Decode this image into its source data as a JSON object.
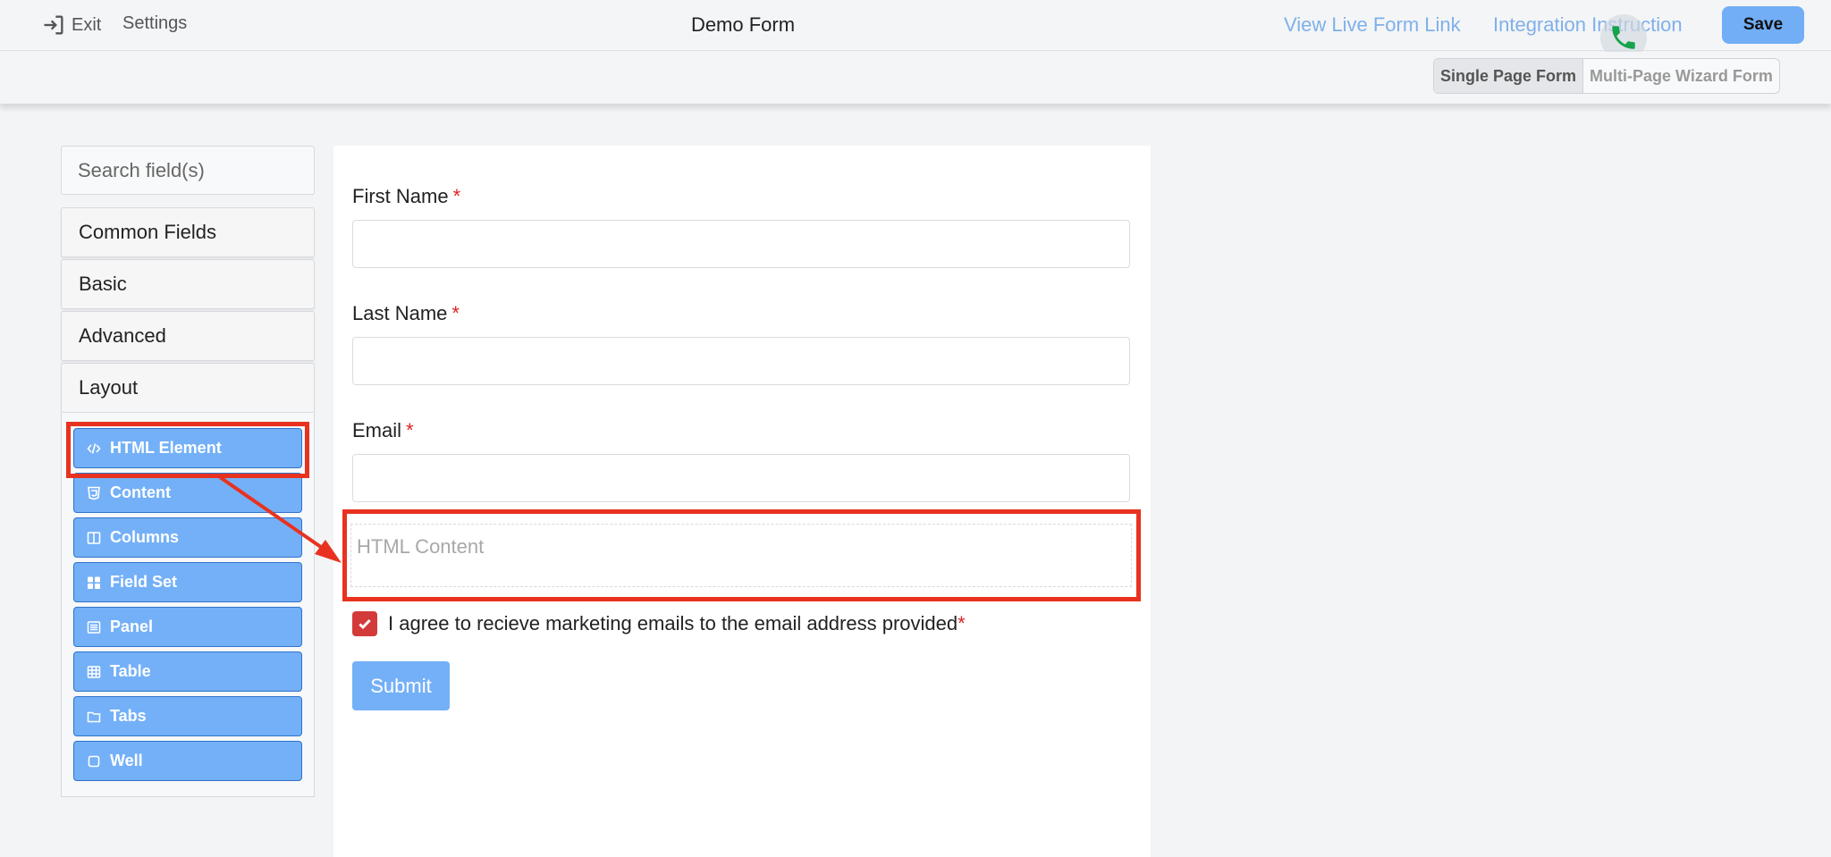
{
  "header": {
    "exit_label": "Exit",
    "settings_label": "Settings",
    "title": "Demo Form",
    "live_link_label": "View Live Form Link",
    "integration_label": "Integration Instruction",
    "save_label": "Save"
  },
  "mode_toggle": {
    "single_label": "Single Page Form",
    "wizard_label": "Multi-Page Wizard Form",
    "selected": "Single Page Form"
  },
  "sidebar": {
    "search_placeholder": "Search field(s)",
    "groups": [
      "Common Fields",
      "Basic",
      "Advanced",
      "Layout"
    ],
    "layout_components": [
      {
        "label": "HTML Element",
        "icon": "code-icon"
      },
      {
        "label": "Content",
        "icon": "html5-icon"
      },
      {
        "label": "Columns",
        "icon": "columns-icon"
      },
      {
        "label": "Field Set",
        "icon": "th-large-icon"
      },
      {
        "label": "Panel",
        "icon": "list-alt-icon"
      },
      {
        "label": "Table",
        "icon": "table-icon"
      },
      {
        "label": "Tabs",
        "icon": "folder-icon"
      },
      {
        "label": "Well",
        "icon": "square-icon"
      }
    ]
  },
  "form": {
    "fields": [
      {
        "label": "First Name",
        "required": "*"
      },
      {
        "label": "Last Name",
        "required": "*"
      },
      {
        "label": "Email",
        "required": "*"
      }
    ],
    "html_content_placeholder": "HTML Content",
    "consent_label": "I agree to recieve marketing emails to the email address provided",
    "consent_required": "*",
    "consent_checked": true,
    "submit_label": "Submit"
  },
  "colors": {
    "accent": "#74b0f7",
    "link": "#7fb0ea",
    "annotation": "#e8321f",
    "required": "#dd2222",
    "checkbox": "#d33b3b"
  }
}
